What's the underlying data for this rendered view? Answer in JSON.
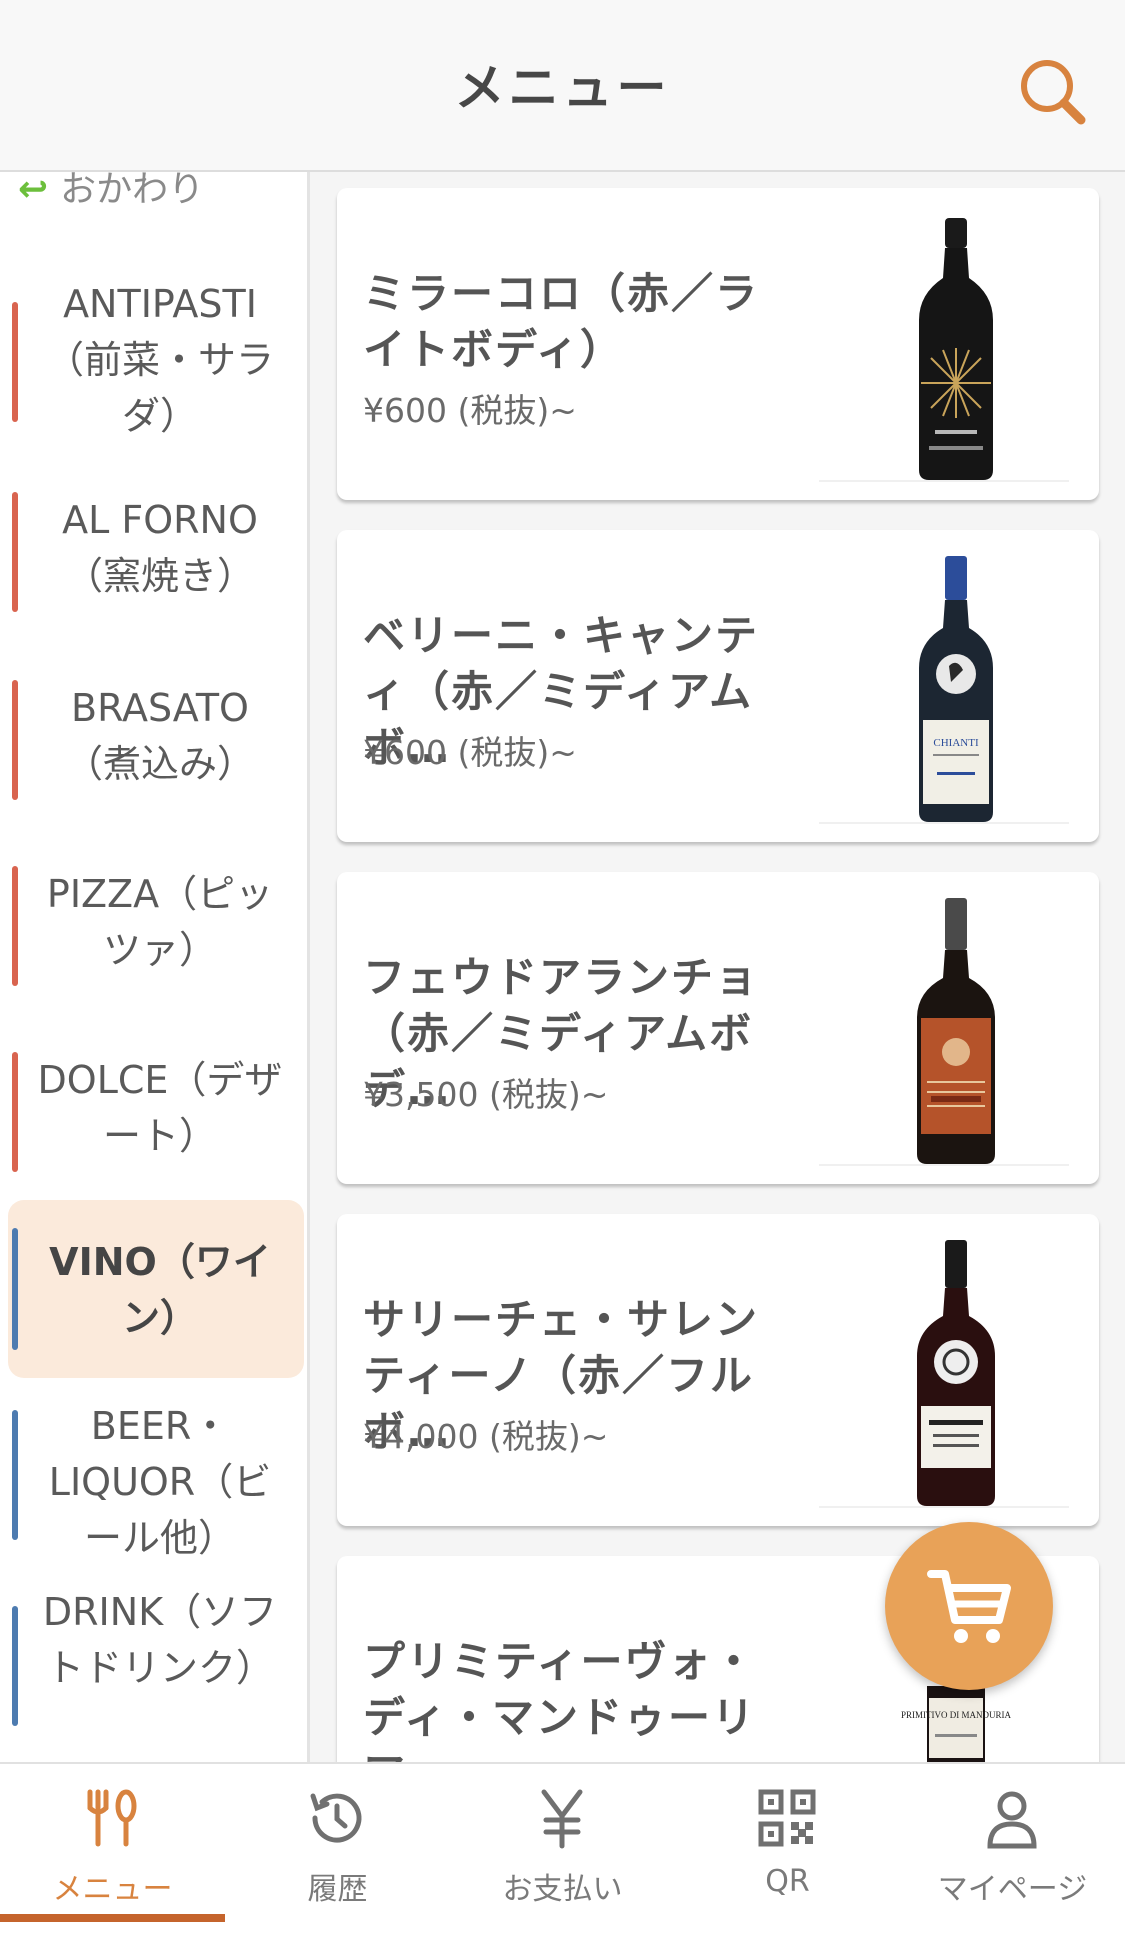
{
  "header": {
    "title": "メニュー"
  },
  "sidebar": {
    "top_item": {
      "arrow": "↩",
      "label": "おかわり"
    },
    "categories": [
      {
        "label": "ANTIPASTI（前菜・サラダ）",
        "bar_color": "#d9644f"
      },
      {
        "label": "AL FORNO（窯焼き）",
        "bar_color": "#d9644f"
      },
      {
        "label": "BRASATO（煮込み）",
        "bar_color": "#d9644f"
      },
      {
        "label": "PIZZA（ピッツァ）",
        "bar_color": "#d9644f"
      },
      {
        "label": "DOLCE（デザート）",
        "bar_color": "#d9644f"
      },
      {
        "label": "VINO（ワイン）",
        "bar_color": "#4d7bb0",
        "active": true
      },
      {
        "label": "BEER・LIQUOR（ビール他）",
        "bar_color": "#4d7bb0"
      },
      {
        "label": "DRINK（ソフトドリンク）",
        "bar_color": "#4d7bb0"
      }
    ]
  },
  "items": [
    {
      "name": "ミラーコロ（赤／ライトボディ）",
      "price": "¥600 (税抜)~",
      "image": "wine-bottle-miracolo"
    },
    {
      "name": "ベリーニ・キャンティ（赤／ミディアムボ…",
      "price": "¥600 (税抜)~",
      "image": "wine-bottle-chianti",
      "label_text": "CHIANTI"
    },
    {
      "name": "フェウドアランチョ（赤／ミディアムボデ…",
      "price": "¥3,500 (税抜)~",
      "image": "wine-bottle-feudo-arancio"
    },
    {
      "name": "サリーチェ・サレンティーノ（赤／フルボ…",
      "price": "¥4,000 (税抜)~",
      "image": "wine-bottle-salice-salentino"
    },
    {
      "name": "プリミティーヴォ・ディ・マンドゥーリア…",
      "price": "",
      "image": "wine-bottle-primitivo",
      "label_text": "PRIMITIVO DI MANDURIA"
    }
  ],
  "tabs": [
    {
      "label": "メニュー",
      "icon": "cutlery-icon",
      "active": true
    },
    {
      "label": "履歴",
      "icon": "history-icon"
    },
    {
      "label": "お支払い",
      "icon": "yen-icon"
    },
    {
      "label": "QR",
      "icon": "qr-code-icon"
    },
    {
      "label": "マイページ",
      "icon": "user-icon"
    }
  ],
  "colors": {
    "accent": "#d8833f",
    "cart": "#e8a258",
    "active_bg": "#fbeadb"
  }
}
